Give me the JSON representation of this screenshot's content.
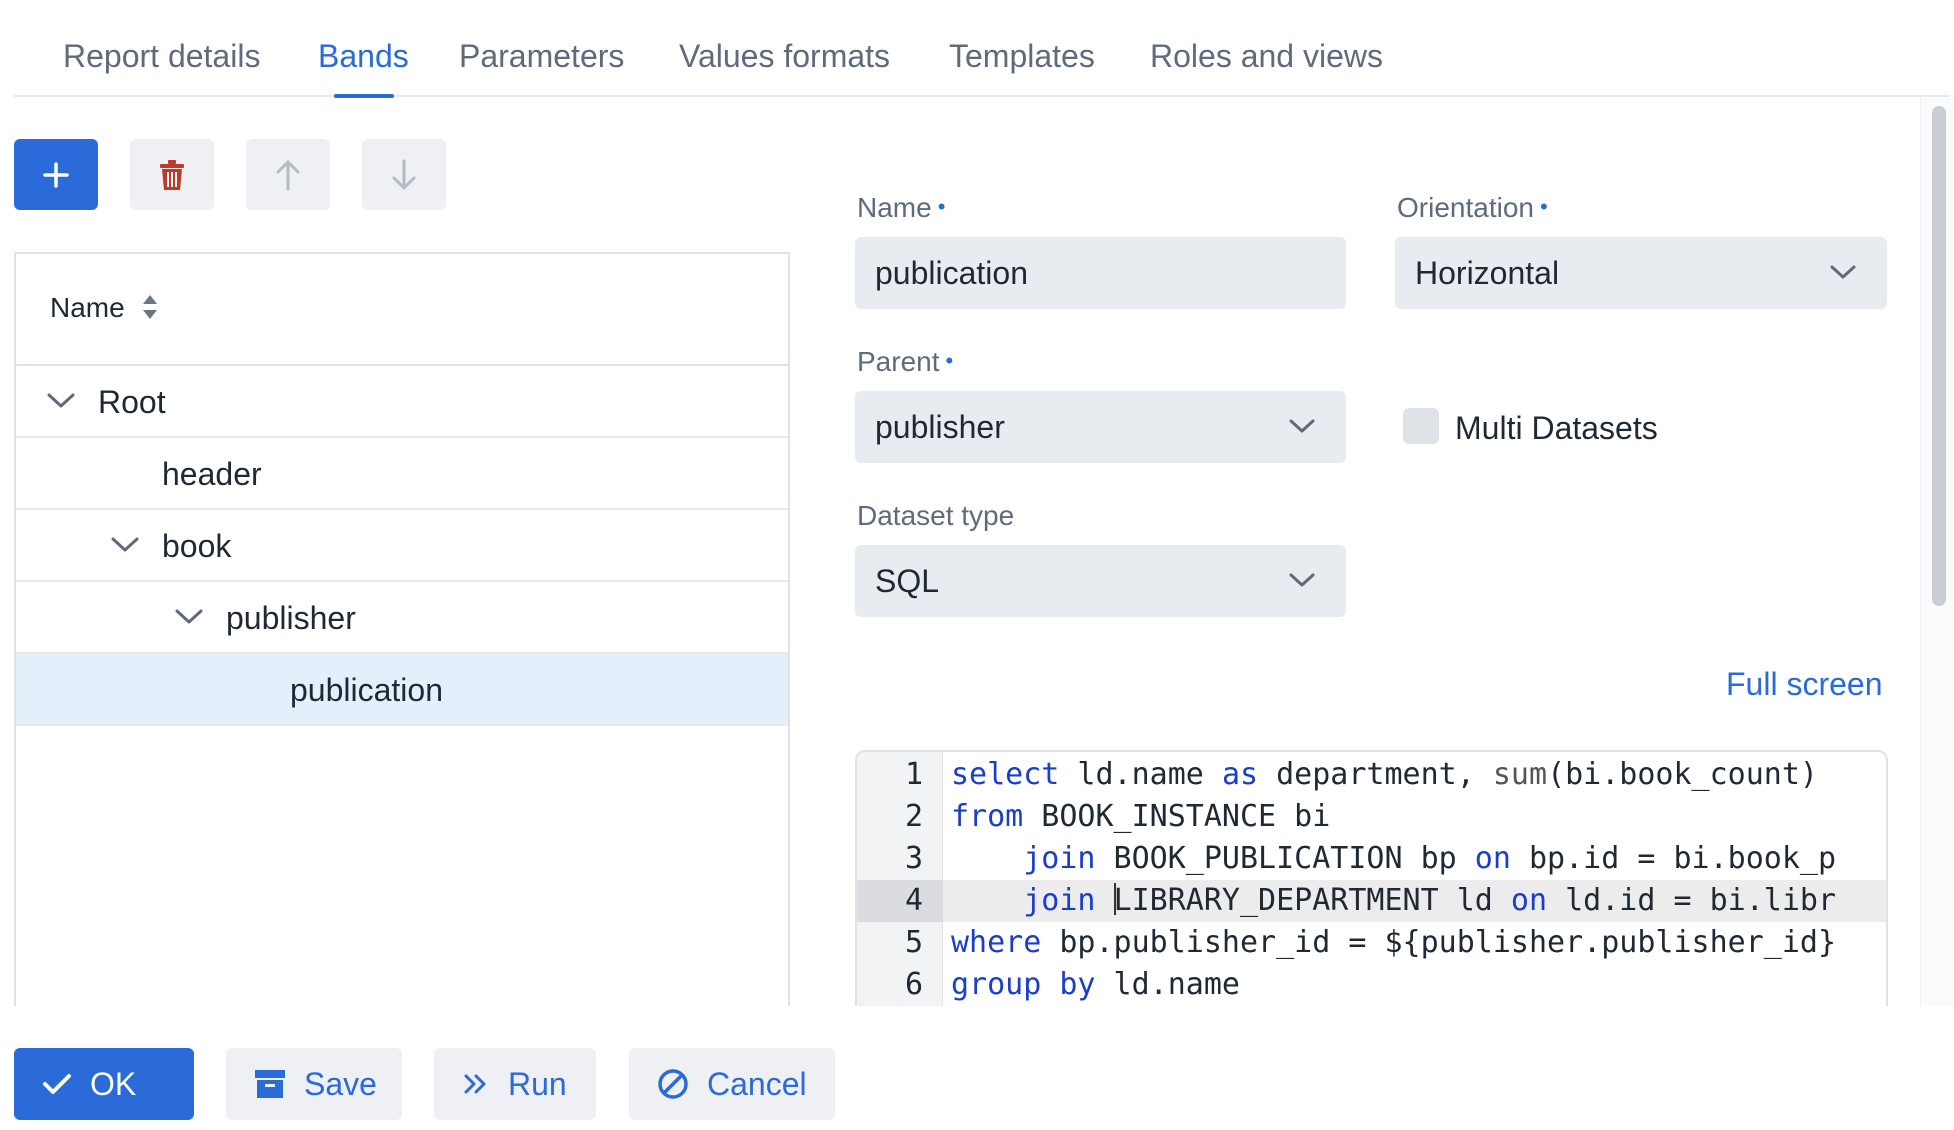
{
  "tabs": [
    {
      "label": "Report details"
    },
    {
      "label": "Bands"
    },
    {
      "label": "Parameters"
    },
    {
      "label": "Values formats"
    },
    {
      "label": "Templates"
    },
    {
      "label": "Roles and views"
    }
  ],
  "active_tab": "Bands",
  "toolbar": {
    "add": "plus-icon",
    "delete": "trash-icon",
    "move_up": "arrow-up-icon",
    "move_down": "arrow-down-icon"
  },
  "tree": {
    "header": "Name",
    "rows": [
      {
        "label": "Root",
        "expanded": true
      },
      {
        "label": "header"
      },
      {
        "label": "book",
        "expanded": true
      },
      {
        "label": "publisher",
        "expanded": true
      },
      {
        "label": "publication",
        "selected": true
      }
    ]
  },
  "form": {
    "name_label": "Name",
    "name_value": "publication",
    "orientation_label": "Orientation",
    "orientation_value": "Horizontal",
    "parent_label": "Parent",
    "parent_value": "publisher",
    "multi_datasets_label": "Multi Datasets",
    "multi_datasets_checked": false,
    "dataset_type_label": "Dataset type",
    "dataset_type_value": "SQL",
    "full_screen_link": "Full screen",
    "required_marker": "•"
  },
  "editor": {
    "lines": [
      {
        "n": "1",
        "tokens": [
          {
            "t": "select",
            "c": "kw"
          },
          {
            "t": " ld.name "
          },
          {
            "t": "as",
            "c": "kw"
          },
          {
            "t": " department, "
          },
          {
            "t": "sum",
            "c": "fn"
          },
          {
            "t": "(bi.book_count)"
          }
        ]
      },
      {
        "n": "2",
        "tokens": [
          {
            "t": "from",
            "c": "kw"
          },
          {
            "t": " BOOK_INSTANCE bi"
          }
        ]
      },
      {
        "n": "3",
        "tokens": [
          {
            "t": "    "
          },
          {
            "t": "join",
            "c": "kw"
          },
          {
            "t": " BOOK_PUBLICATION bp "
          },
          {
            "t": "on",
            "c": "kw"
          },
          {
            "t": " bp.id = bi.book_p"
          }
        ]
      },
      {
        "n": "4",
        "active": true,
        "tokens": [
          {
            "t": "    "
          },
          {
            "t": "join",
            "c": "kw"
          },
          {
            "t": " "
          },
          {
            "t": "|",
            "c": "caret"
          },
          {
            "t": "LIBRARY_DEPARTMENT ld "
          },
          {
            "t": "on",
            "c": "kw"
          },
          {
            "t": " ld.id = bi.libr"
          }
        ]
      },
      {
        "n": "5",
        "tokens": [
          {
            "t": "where",
            "c": "kw"
          },
          {
            "t": " bp.publisher_id = ${publisher.publisher_id}"
          }
        ]
      },
      {
        "n": "6",
        "tokens": [
          {
            "t": "group by",
            "c": "kw"
          },
          {
            "t": " ld.name"
          }
        ]
      }
    ]
  },
  "footer": {
    "ok": "OK",
    "save": "Save",
    "run": "Run",
    "cancel": "Cancel"
  },
  "colors": {
    "accent": "#2a6ad9",
    "danger": "#c0392b",
    "selected_row": "#e5effc",
    "field_bg": "#e8ebef"
  }
}
